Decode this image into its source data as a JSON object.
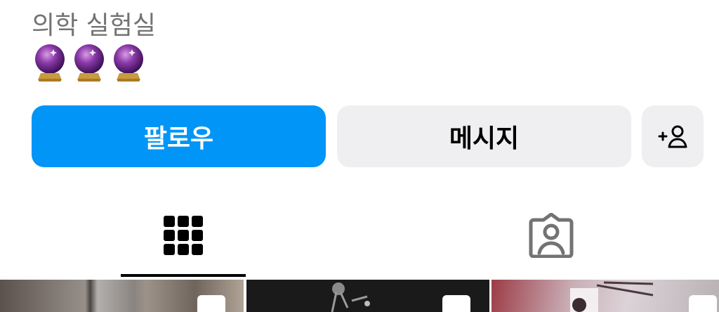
{
  "profile": {
    "category": "의학 실험실",
    "bio_emojis": [
      "crystal-ball",
      "crystal-ball",
      "crystal-ball"
    ]
  },
  "actions": {
    "follow_label": "팔로우",
    "message_label": "메시지",
    "suggest_icon": "person-add-icon",
    "follow_color": "#0095f6",
    "secondary_color": "#efeff1"
  },
  "tabs": [
    {
      "icon": "grid-icon",
      "active": true
    },
    {
      "icon": "tagged-person-icon",
      "active": false
    }
  ],
  "posts": [
    {
      "icon": "multi-post-icon"
    },
    {
      "icon": "multi-post-icon"
    },
    {
      "icon": "multi-post-icon"
    }
  ]
}
